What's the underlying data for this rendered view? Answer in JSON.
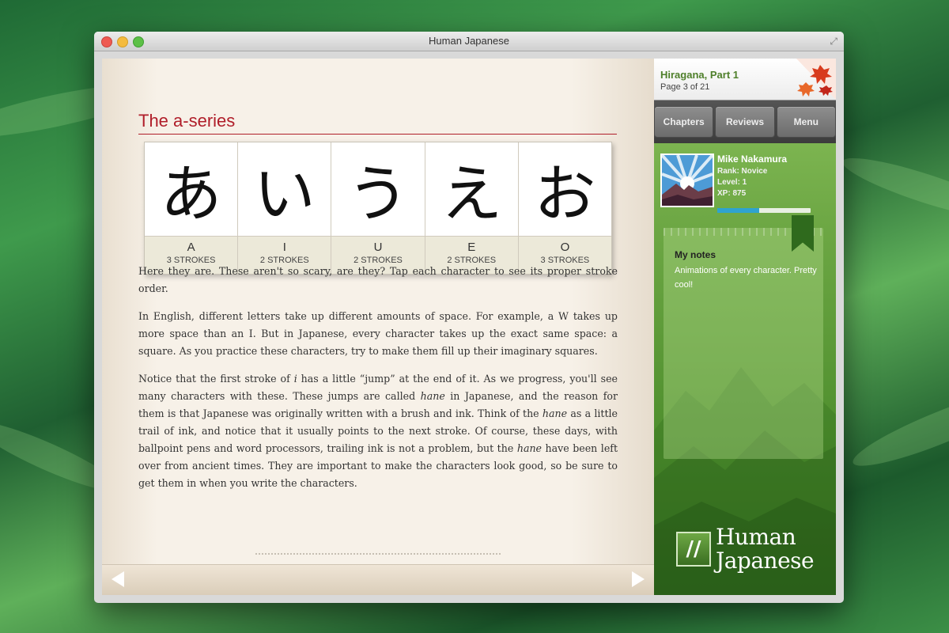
{
  "window": {
    "title": "Human Japanese"
  },
  "lesson": {
    "title": "The a-series",
    "kana": [
      {
        "char": "あ",
        "romaji": "A",
        "strokes": "3 STROKES"
      },
      {
        "char": "い",
        "romaji": "I",
        "strokes": "2 STROKES"
      },
      {
        "char": "う",
        "romaji": "U",
        "strokes": "2 STROKES"
      },
      {
        "char": "え",
        "romaji": "E",
        "strokes": "2 STROKES"
      },
      {
        "char": "お",
        "romaji": "O",
        "strokes": "3 STROKES"
      }
    ],
    "paragraphs": [
      "Here they are. These aren't so scary, are they? Tap each character to see its proper stroke order.",
      "In English, different letters take up different amounts of space. For example, a W takes up more space than an I. But in Japanese, every character takes up the exact same space: a square. As you practice these characters, try to make them fill up their imaginary squares.",
      "Notice that the first stroke of <i>i</i> has a little “jump” at the end of it. As we progress, you'll see many characters with these. These jumps are called <i>hane</i> in Japanese, and the reason for them is that Japanese was originally written with a brush and ink. Think of the <i>hane</i> as a little trail of ink, and notice that it usually points to the next stroke. Of course, these days, with ballpoint pens and word processors, trailing ink is not a problem, but the <i>hane</i> have been left over from ancient times. They are important to make the characters look good, so be sure to get them in when you write the characters."
    ]
  },
  "sidebar": {
    "chapter": "Hiragana, Part 1",
    "page": "Page 3 of 21",
    "buttons": [
      "Chapters",
      "Reviews",
      "Menu"
    ],
    "user": {
      "name": "Mike Nakamura",
      "rank": "Rank: Novice",
      "level": "Level: 1",
      "xp": "XP: 875",
      "xp_progress": 0.45
    },
    "notes": {
      "title": "My notes",
      "text": "Animations of every character. Pretty cool!"
    },
    "brand": {
      "line1": "Human",
      "line2": "Japanese"
    }
  },
  "colors": {
    "title_red": "#b01e2a",
    "sidebar_green": "#6ea845",
    "xp_blue": "#2fa3cf"
  },
  "icons": [
    "window-close-icon",
    "window-minimize-icon",
    "window-zoom-icon",
    "fullscreen-icon",
    "maple-leaves-icon",
    "bookmark-icon",
    "prev-page-arrow-icon",
    "next-page-arrow-icon",
    "human-japanese-logo-icon"
  ]
}
